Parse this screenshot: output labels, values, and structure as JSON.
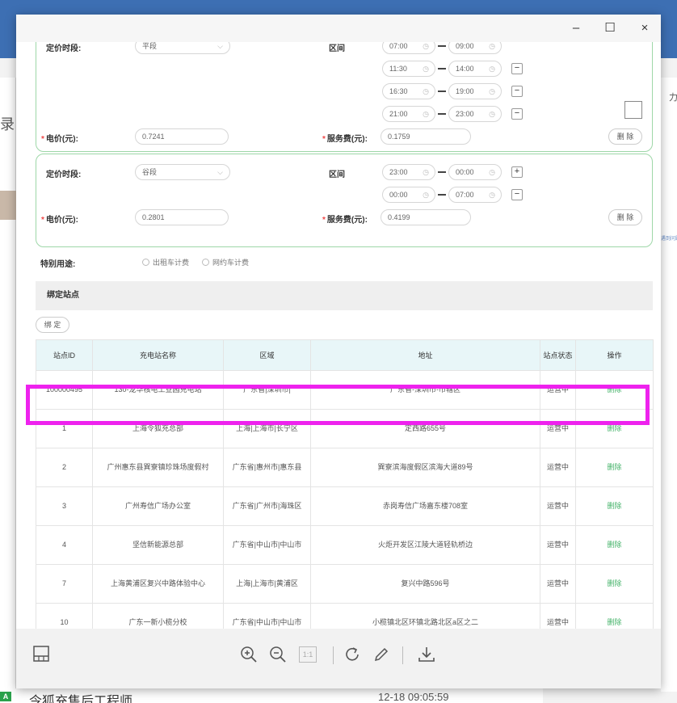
{
  "background": {
    "left_char": "录",
    "right_char": "力",
    "right_note": "遇到问题请",
    "footer_name": "令狐充售后工程师",
    "footer_time": "12-18 09:05:59",
    "footer_icon": "A"
  },
  "window": {
    "minimize": "–",
    "maximize": "☐",
    "close": "×"
  },
  "group1": {
    "period_label": "定价时段:",
    "period_value": "平段",
    "interval_label": "区间",
    "intervals": [
      {
        "start": "07:00",
        "end": "09:00"
      },
      {
        "start": "11:30",
        "end": "14:00"
      },
      {
        "start": "16:30",
        "end": "19:00"
      },
      {
        "start": "21:00",
        "end": "23:00"
      }
    ],
    "price_label": "电价(元):",
    "price_value": "0.7241",
    "fee_label": "服务费(元):",
    "fee_value": "0.1759",
    "delete": "删 除"
  },
  "group2": {
    "period_label": "定价时段:",
    "period_value": "谷段",
    "interval_label": "区间",
    "intervals": [
      {
        "start": "23:00",
        "end": "00:00"
      },
      {
        "start": "00:00",
        "end": "07:00"
      }
    ],
    "price_label": "电价(元):",
    "price_value": "0.2801",
    "fee_label": "服务费(元):",
    "fee_value": "0.4199",
    "delete": "删 除"
  },
  "special": {
    "label": "特别用途:",
    "options": [
      "出租车计费",
      "网约车计费"
    ]
  },
  "stations": {
    "section_title": "绑定站点",
    "bind_button": "绑 定",
    "headers": [
      "站点ID",
      "充电站名称",
      "区域",
      "地址",
      "站点状态",
      "操作"
    ],
    "rows": [
      {
        "id": "100000495",
        "name": "130-龙华核电工业园充电站",
        "region": "广东省|深圳市|",
        "address": "广东省-深圳市-市辖区",
        "status": "运营中",
        "op": "删除"
      },
      {
        "id": "1",
        "name": "上海令狐充总部",
        "region": "上海|上海市|长宁区",
        "address": "定西路655号",
        "status": "运营中",
        "op": "删除"
      },
      {
        "id": "2",
        "name": "广州惠东县巽寮镇珍珠场度假村",
        "region": "广东省|惠州市|惠东县",
        "address": "巽寮滨海度假区滨海大道89号",
        "status": "运营中",
        "op": "删除"
      },
      {
        "id": "3",
        "name": "广州寿信广场办公室",
        "region": "广东省|广州市|海珠区",
        "address": "赤岗寿信广场嘉东楼708室",
        "status": "运营中",
        "op": "删除"
      },
      {
        "id": "4",
        "name": "坚信新能源总部",
        "region": "广东省|中山市|中山市",
        "address": "火炬开发区江陵大道轻轨桥边",
        "status": "运营中",
        "op": "删除"
      },
      {
        "id": "7",
        "name": "上海黄浦区复兴中路体验中心",
        "region": "上海|上海市|黄浦区",
        "address": "复兴中路596号",
        "status": "运营中",
        "op": "删除"
      },
      {
        "id": "10",
        "name": "广东一新小榄分校",
        "region": "广东省|中山市|中山市",
        "address": "小榄镇北区环镇北路北区a区之二",
        "status": "运营中",
        "op": "删除"
      }
    ]
  },
  "toolbar": {
    "zoom_reset": "1:1"
  },
  "colors": {
    "highlight": "#ee22ee",
    "group_border": "#9ed7a8",
    "delete_link": "#45b36a",
    "table_header": "#e8f6f8",
    "required": "#f04848"
  }
}
